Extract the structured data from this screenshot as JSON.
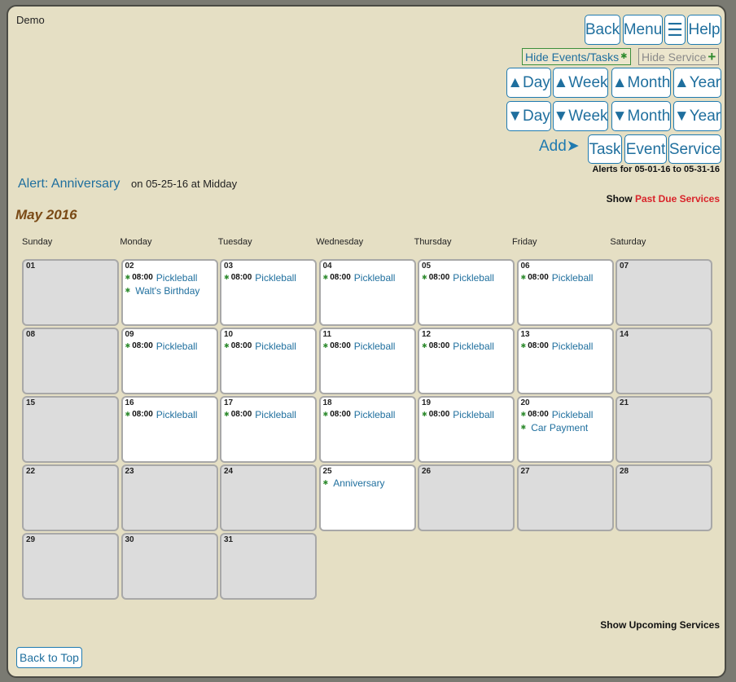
{
  "app": {
    "user": "Demo"
  },
  "nav": {
    "back": "Back",
    "menu": "Menu",
    "hamburger": "☰",
    "help": "Help",
    "hide_events": "Hide Events/Tasks",
    "hide_events_icon": "✱",
    "hide_service": "Hide Service",
    "hide_service_icon": "+",
    "up_day": "▲Day",
    "up_week": "▲Week",
    "up_month": "▲Month",
    "up_year": "▲Year",
    "down_day": "▼Day",
    "down_week": "▼Week",
    "down_month": "▼Month",
    "down_year": "▼Year",
    "add_label": "Add➤",
    "add_task": "Task",
    "add_event": "Event",
    "add_service": "Service"
  },
  "alerts": {
    "range": "Alerts for 05-01-16 to 05-31-16",
    "alert_link": "Alert: Anniversary",
    "alert_detail": "on 05-25-16 at Midday",
    "show_label": "Show",
    "past_due": "Past Due Services"
  },
  "calendar": {
    "title": "May 2016",
    "days_of_week": [
      "Sunday",
      "Monday",
      "Tuesday",
      "Wednesday",
      "Thursday",
      "Friday",
      "Saturday"
    ],
    "start_weekday": 0,
    "days": [
      {
        "num": "01",
        "events": []
      },
      {
        "num": "02",
        "events": [
          {
            "time": "08:00",
            "name": "Pickleball"
          },
          {
            "time": "",
            "name": "Walt's Birthday"
          }
        ]
      },
      {
        "num": "03",
        "events": [
          {
            "time": "08:00",
            "name": "Pickleball"
          }
        ]
      },
      {
        "num": "04",
        "events": [
          {
            "time": "08:00",
            "name": "Pickleball"
          }
        ]
      },
      {
        "num": "05",
        "events": [
          {
            "time": "08:00",
            "name": "Pickleball"
          }
        ]
      },
      {
        "num": "06",
        "events": [
          {
            "time": "08:00",
            "name": "Pickleball"
          }
        ]
      },
      {
        "num": "07",
        "events": []
      },
      {
        "num": "08",
        "events": []
      },
      {
        "num": "09",
        "events": [
          {
            "time": "08:00",
            "name": "Pickleball"
          }
        ]
      },
      {
        "num": "10",
        "events": [
          {
            "time": "08:00",
            "name": "Pickleball"
          }
        ]
      },
      {
        "num": "11",
        "events": [
          {
            "time": "08:00",
            "name": "Pickleball"
          }
        ]
      },
      {
        "num": "12",
        "events": [
          {
            "time": "08:00",
            "name": "Pickleball"
          }
        ]
      },
      {
        "num": "13",
        "events": [
          {
            "time": "08:00",
            "name": "Pickleball"
          }
        ]
      },
      {
        "num": "14",
        "events": []
      },
      {
        "num": "15",
        "events": []
      },
      {
        "num": "16",
        "events": [
          {
            "time": "08:00",
            "name": "Pickleball"
          }
        ]
      },
      {
        "num": "17",
        "events": [
          {
            "time": "08:00",
            "name": "Pickleball"
          }
        ]
      },
      {
        "num": "18",
        "events": [
          {
            "time": "08:00",
            "name": "Pickleball"
          }
        ]
      },
      {
        "num": "19",
        "events": [
          {
            "time": "08:00",
            "name": "Pickleball"
          }
        ]
      },
      {
        "num": "20",
        "events": [
          {
            "time": "08:00",
            "name": "Pickleball"
          },
          {
            "time": "",
            "name": "Car Payment"
          }
        ]
      },
      {
        "num": "21",
        "events": []
      },
      {
        "num": "22",
        "events": []
      },
      {
        "num": "23",
        "events": []
      },
      {
        "num": "24",
        "events": []
      },
      {
        "num": "25",
        "events": [
          {
            "time": "",
            "name": "Anniversary"
          }
        ]
      },
      {
        "num": "26",
        "events": []
      },
      {
        "num": "27",
        "events": []
      },
      {
        "num": "28",
        "events": []
      },
      {
        "num": "29",
        "events": []
      },
      {
        "num": "30",
        "events": []
      },
      {
        "num": "31",
        "events": []
      }
    ],
    "event_icon": "✱"
  },
  "footer": {
    "show_upcoming": "Show Upcoming Services",
    "back_to_top": "Back to Top"
  },
  "colors": {
    "background": "#e5dfc4",
    "link": "#1f6f9e",
    "accent_green": "#2d8a2d",
    "past_due_red": "#d9232a",
    "title_brown": "#7a4a16"
  }
}
